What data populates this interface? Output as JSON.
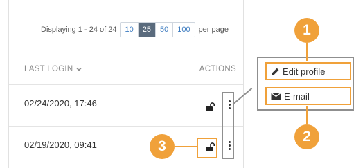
{
  "pager": {
    "label": "Displaying 1 - 24 of 24",
    "sizes": [
      "10",
      "25",
      "50",
      "100"
    ],
    "selected": "25",
    "suffix": "per page"
  },
  "table": {
    "columns": {
      "last_login": "LAST LOGIN",
      "actions": "ACTIONS"
    },
    "rows": [
      {
        "last_login": "02/24/2020, 17:46"
      },
      {
        "last_login": "02/19/2020, 09:41"
      }
    ]
  },
  "action_menu": {
    "items": [
      {
        "label": "Edit profile",
        "icon": "pencil-icon"
      },
      {
        "label": "E-mail",
        "icon": "envelope-icon"
      }
    ]
  },
  "callouts": [
    "1",
    "2",
    "3"
  ],
  "colors": {
    "accent": "#f0a13a",
    "selected_page_size": "#5a6b7d",
    "link": "#3c7bc0",
    "outline": "#8f8f8f"
  }
}
